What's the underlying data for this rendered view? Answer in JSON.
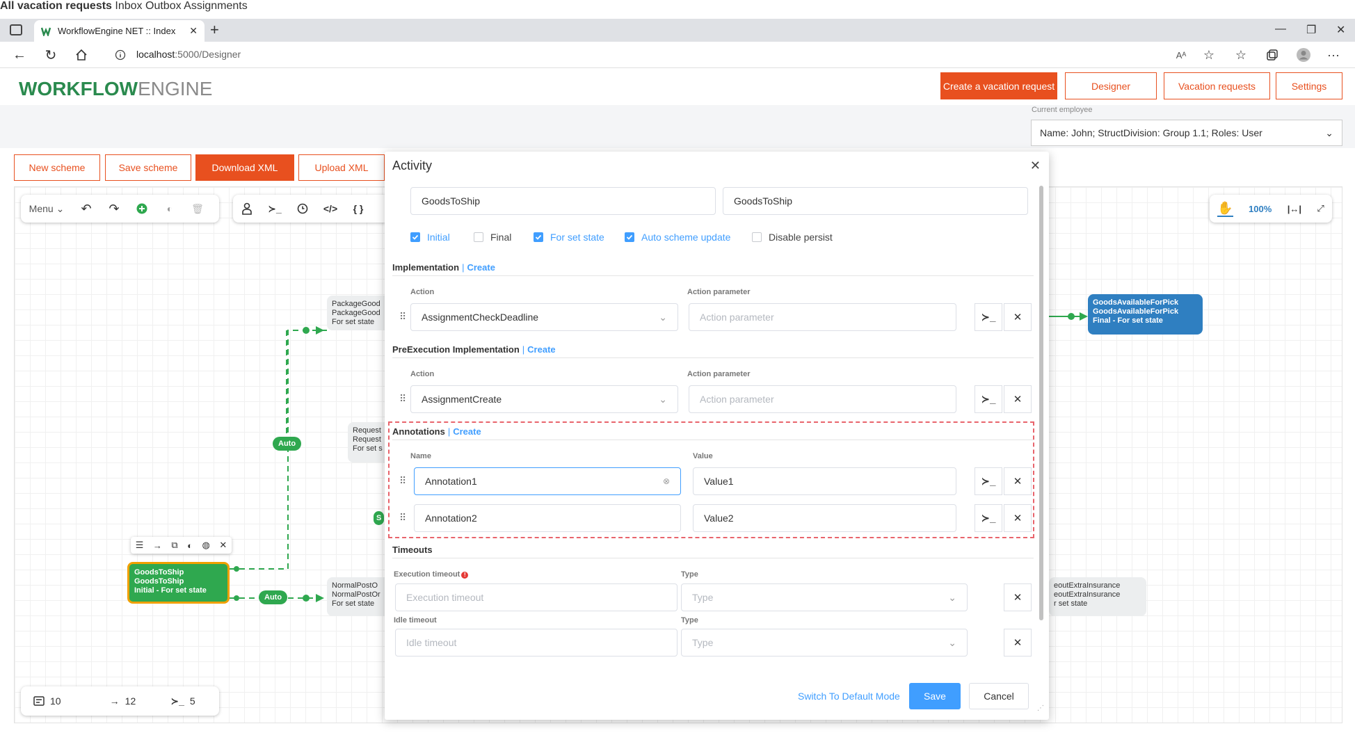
{
  "browser": {
    "tab_title": "WorkflowEngine NET :: Index",
    "url_host": "localhost",
    "url_path": ":5000/Designer",
    "new_tab": "+"
  },
  "header": {
    "logo_bold": "WORKFLOW",
    "logo_light": "ENGINE",
    "buttons": [
      "Create a vacation request",
      "Designer",
      "Vacation requests",
      "Settings"
    ]
  },
  "subnav": {
    "links": [
      "All vacation requests",
      "Inbox",
      "Outbox",
      "Assignments"
    ],
    "employee_label": "Current employee",
    "employee_value": "Name: John; StructDivision: Group 1.1; Roles: User"
  },
  "designer": {
    "buttons": [
      "New scheme",
      "Save scheme",
      "Download XML",
      "Upload XML"
    ],
    "menu_label": "Menu",
    "zoom": "100%",
    "counts": {
      "activities": "10",
      "transitions": "12",
      "commands": "5"
    },
    "states": {
      "package": [
        "PackageGood",
        "PackageGood",
        "For set state"
      ],
      "request": [
        "Request",
        "Request",
        "For set s"
      ],
      "normal": [
        "NormalPostO",
        "NormalPostOr",
        "For set state"
      ],
      "available": [
        "GoodsAvailableForPick",
        "GoodsAvailableForPick",
        "Final - For set state"
      ],
      "goods": [
        "GoodsToShip",
        "GoodsToShip",
        "Initial - For set state"
      ],
      "checkout": [
        "eoutExtraInsurance",
        "eoutExtraInsurance",
        "r set state"
      ]
    },
    "auto_label": "Auto",
    "s_label": "S"
  },
  "modal": {
    "title": "Activity",
    "name": "GoodsToShip",
    "state": "GoodsToShip",
    "checkboxes": [
      {
        "label": "Initial",
        "checked": true
      },
      {
        "label": "Final",
        "checked": false
      },
      {
        "label": "For set state",
        "checked": true
      },
      {
        "label": "Auto scheme update",
        "checked": true
      },
      {
        "label": "Disable persist",
        "checked": false
      }
    ],
    "implementation": {
      "title": "Implementation",
      "create": "Create",
      "action_label": "Action",
      "param_label": "Action parameter",
      "action": "AssignmentCheckDeadline",
      "param_placeholder": "Action parameter"
    },
    "pre_implementation": {
      "title": "PreExecution Implementation",
      "create": "Create",
      "action_label": "Action",
      "param_label": "Action parameter",
      "action": "AssignmentCreate",
      "param_placeholder": "Action parameter"
    },
    "annotations": {
      "title": "Annotations",
      "create": "Create",
      "name_label": "Name",
      "value_label": "Value",
      "rows": [
        {
          "name": "Annotation1",
          "value": "Value1"
        },
        {
          "name": "Annotation2",
          "value": "Value2"
        }
      ]
    },
    "timeouts": {
      "title": "Timeouts",
      "exec_label": "Execution timeout",
      "exec_placeholder": "Execution timeout",
      "type_label": "Type",
      "type_placeholder": "Type",
      "idle_label": "Idle timeout",
      "idle_placeholder": "Idle timeout"
    },
    "footer": {
      "switch": "Switch To Default Mode",
      "save": "Save",
      "cancel": "Cancel"
    }
  },
  "colors": {
    "brand_orange": "#e8501f",
    "brand_green": "#2a8a4e",
    "accent_blue": "#409eff",
    "state_blue": "#2f7fc1",
    "auto_green": "#2fa84f"
  }
}
